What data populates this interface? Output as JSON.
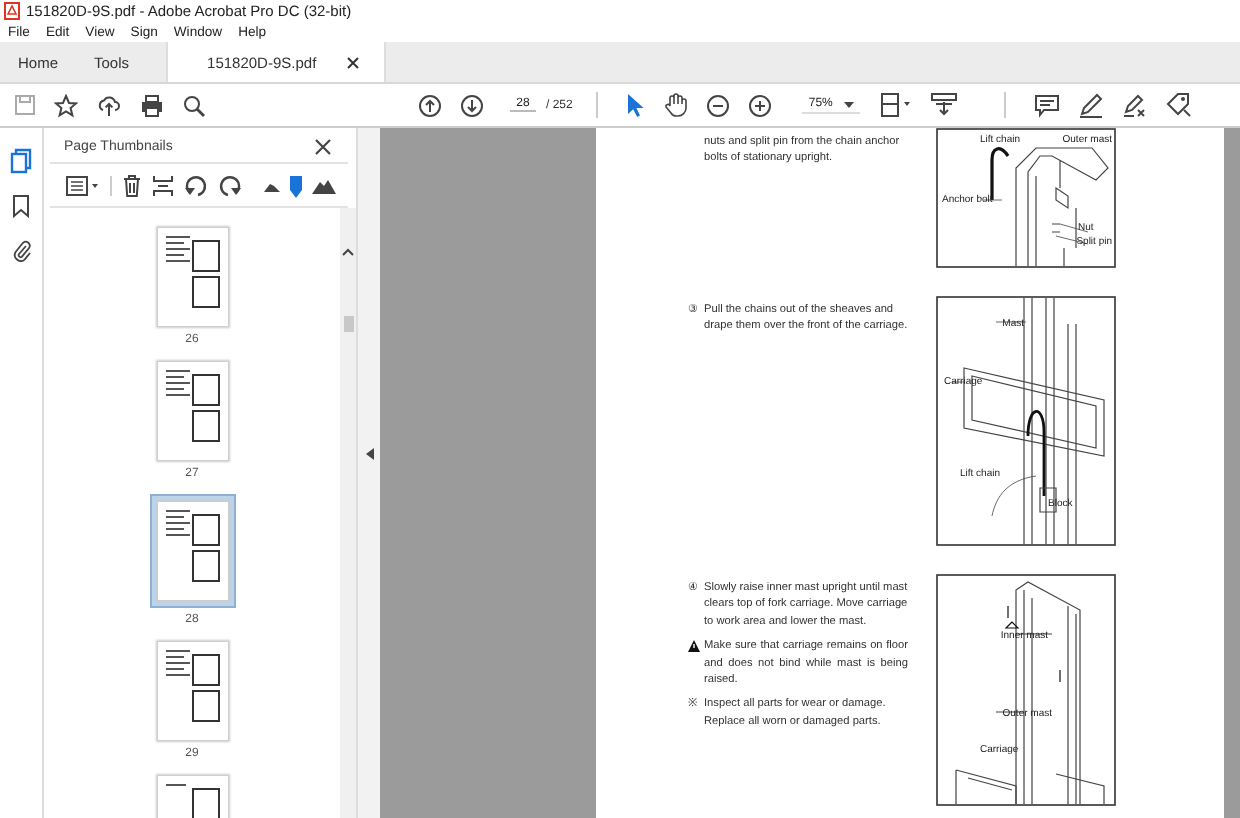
{
  "window": {
    "title": "151820D-9S.pdf - Adobe Acrobat Pro DC (32-bit)"
  },
  "menu": [
    "File",
    "Edit",
    "View",
    "Sign",
    "Window",
    "Help"
  ],
  "tabs": [
    {
      "label": "Home",
      "selected": false,
      "closable": false
    },
    {
      "label": "Tools",
      "selected": false,
      "closable": false
    },
    {
      "label": "151820D-9S.pdf",
      "selected": true,
      "closable": true
    }
  ],
  "toolbar": {
    "page": "28",
    "page_count": "/ 252",
    "zoom": "75%"
  },
  "side_panel": {
    "title": "Page Thumbnails",
    "thumbnails": [
      {
        "label": "26",
        "selected": false
      },
      {
        "label": "27",
        "selected": false
      },
      {
        "label": "28",
        "selected": true
      },
      {
        "label": "29",
        "selected": false
      }
    ]
  },
  "document": {
    "sections": [
      {
        "items": [
          {
            "kind": "continuation",
            "text": "nuts and split pin from the chain anchor bolts of stationary upright."
          }
        ],
        "figure": {
          "kind": "anchor",
          "labels": [
            "Lift chain",
            "Outer mast",
            "Anchor bolt",
            "Nut",
            "Split pin"
          ]
        }
      },
      {
        "items": [
          {
            "kind": "step",
            "marker": "③",
            "text": "Pull the chains out of the sheaves and drape them over the front of the carriage."
          }
        ],
        "figure": {
          "kind": "carriage",
          "labels": [
            "Mast",
            "Carriage",
            "Lift chain",
            "Block"
          ]
        }
      },
      {
        "items": [
          {
            "kind": "step",
            "marker": "④",
            "text": "Slowly raise inner mast upright until mast clears top of fork carriage.  Move carriage to work area and lower the mast."
          },
          {
            "kind": "warning",
            "text": "Make sure that carriage remains on floor and does not bind while mast is being raised."
          },
          {
            "kind": "note",
            "marker": "※",
            "text": "Inspect all parts for wear or damage. Replace all worn or damaged parts."
          }
        ],
        "figure": {
          "kind": "mast",
          "labels": [
            "Inner mast",
            "Outer mast",
            "Carriage"
          ]
        }
      }
    ]
  }
}
